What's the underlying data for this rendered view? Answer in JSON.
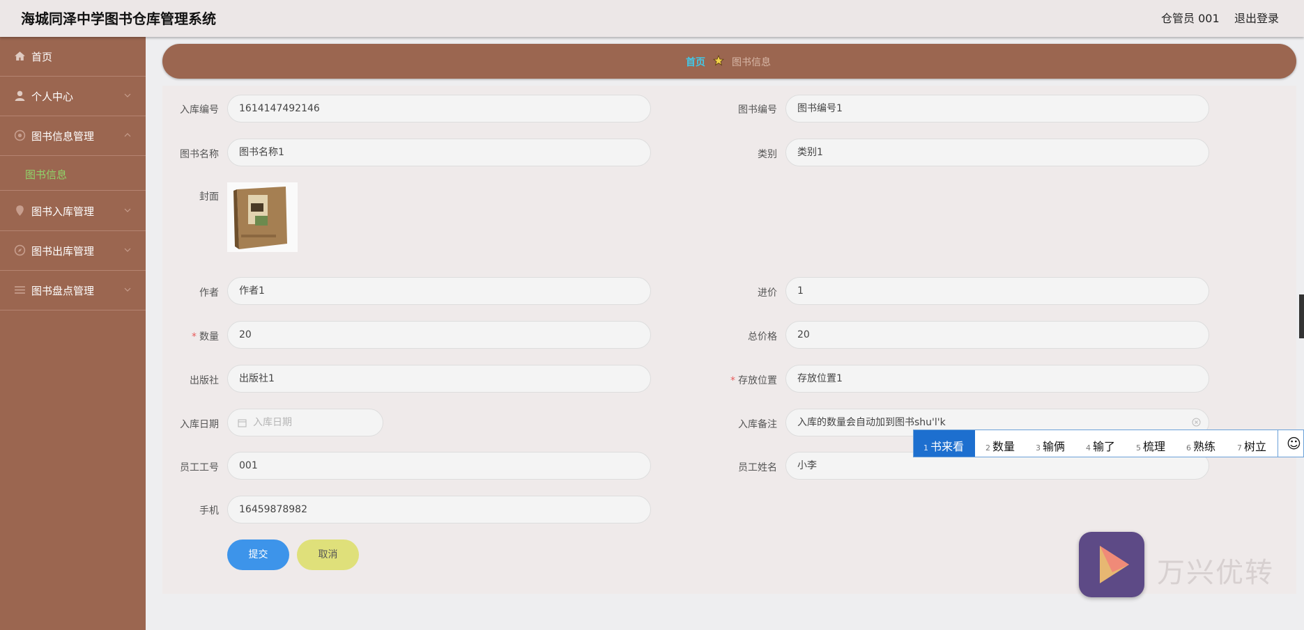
{
  "header": {
    "title": "海城同泽中学图书仓库管理系统",
    "user": "仓管员 001",
    "logout": "退出登录"
  },
  "sidebar": {
    "items": [
      {
        "label": "首页",
        "icon": "home-icon"
      },
      {
        "label": "个人中心",
        "icon": "user-icon"
      },
      {
        "label": "图书信息管理",
        "icon": "book-info-icon"
      },
      {
        "label": "图书入库管理",
        "icon": "location-icon"
      },
      {
        "label": "图书出库管理",
        "icon": "compass-icon"
      },
      {
        "label": "图书盘点管理",
        "icon": "list-icon"
      }
    ],
    "sub_item": "图书信息"
  },
  "breadcrumb": {
    "home": "首页",
    "current": "图书信息"
  },
  "form": {
    "labels": {
      "entry_no": "入库编号",
      "book_no": "图书编号",
      "book_name": "图书名称",
      "category": "类别",
      "cover": "封面",
      "author": "作者",
      "price": "进价",
      "quantity": "数量",
      "total": "总价格",
      "publisher": "出版社",
      "location": "存放位置",
      "entry_date": "入库日期",
      "remark": "入库备注",
      "staff_no": "员工工号",
      "staff_name": "员工姓名",
      "phone": "手机"
    },
    "values": {
      "entry_no": "1614147492146",
      "book_no": "图书编号1",
      "book_name": "图书名称1",
      "category": "类别1",
      "author": "作者1",
      "price": "1",
      "quantity": "20",
      "total": "20",
      "publisher": "出版社1",
      "location": "存放位置1",
      "remark": "入库的数量会自动加到图书shu'l'k",
      "staff_no": "001",
      "staff_name": "小李",
      "phone": "16459878982"
    },
    "placeholders": {
      "entry_date": "入库日期"
    },
    "submit": "提交",
    "cancel": "取消"
  },
  "ime": {
    "candidates": [
      {
        "n": "1",
        "text": "书来看"
      },
      {
        "n": "2",
        "text": "数量"
      },
      {
        "n": "3",
        "text": "输俩"
      },
      {
        "n": "4",
        "text": "输了"
      },
      {
        "n": "5",
        "text": "梳理"
      },
      {
        "n": "6",
        "text": "熟练"
      },
      {
        "n": "7",
        "text": "树立"
      }
    ],
    "emoji": "☺"
  },
  "watermark": "万兴优转",
  "colors": {
    "sidebar": "#9b6650",
    "header": "#ece7e7",
    "accent": "#3d94ea",
    "cancel": "#dfe07a",
    "active_sub": "#8fd46a",
    "crumb_home": "#43c7e6"
  }
}
